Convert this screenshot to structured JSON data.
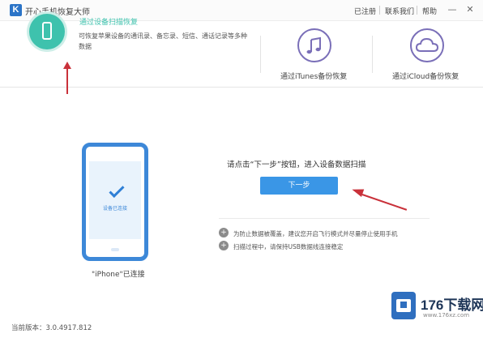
{
  "titlebar": {
    "logo_letter": "K",
    "app_title": "开心手机恢复大师",
    "links": [
      "已注册",
      "联系我们",
      "帮助"
    ],
    "window_controls": [
      "—",
      "✕"
    ]
  },
  "modes": {
    "device": {
      "title": "通过设备扫描恢复",
      "description": "可恢复苹果设备的通讯录、备忘录、短信、通话记录等多种数据",
      "icon": "phone-icon"
    },
    "itunes": {
      "label": "通过iTunes备份恢复",
      "icon": "music-note-icon"
    },
    "icloud": {
      "label": "通过iCloud备份恢复",
      "icon": "cloud-icon"
    }
  },
  "device_panel": {
    "screen_label": "设备已连接",
    "connected_label": "\"iPhone\"已连接"
  },
  "scan": {
    "prompt": "请点击“下一步”按钮，进入设备数据扫描",
    "next_button": "下一步",
    "notes": [
      {
        "icon": "plus-icon",
        "text": "为防止数据被覆盖，建议您开启飞行模式并尽量停止使用手机"
      },
      {
        "icon": "plus-icon",
        "text": "扫描过程中，请保持USB数据线连接稳定"
      }
    ]
  },
  "footer": {
    "version": "当前版本：3.0.4917.812"
  },
  "watermark": {
    "brand": "176下载网",
    "url": "www.176xz.com"
  },
  "colors": {
    "accent_blue": "#3a96e6",
    "accent_green": "#3ec2ad",
    "annotation_red": "#c9313a",
    "mode_purple": "#7a6fb8"
  }
}
